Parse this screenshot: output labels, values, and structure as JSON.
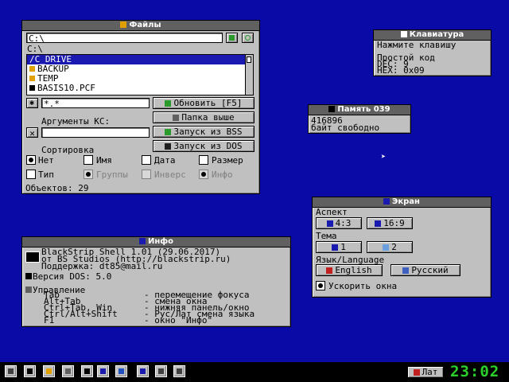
{
  "files_window": {
    "title": "Файлы",
    "path_value": "C:\\",
    "current_dir": "C:\\",
    "items": [
      {
        "label": "/C_DRIVE",
        "selected": true
      },
      {
        "label": "BACKUP",
        "selected": false
      },
      {
        "label": "TEMP",
        "selected": false
      },
      {
        "label": "BASIS10.PCF",
        "selected": false
      }
    ],
    "mask_value": "*.*",
    "refresh_label": "Обновить [F5]",
    "up_label": "Папка выше",
    "args_label": "Аргументы КС:",
    "run_bss_label": "Запуск из BSS",
    "run_dos_label": "Запуск из DOS",
    "sort_label": "Сортировка",
    "sort_none": "Нет",
    "sort_name": "Имя",
    "sort_date": "Дата",
    "sort_size": "Размер",
    "sort_type": "Тип",
    "sort_groups": "Группы",
    "sort_invert": "Инверс",
    "sort_info": "Инфо",
    "object_count": "Объектов: 29"
  },
  "keyboard_window": {
    "title": "Клавиатура",
    "prompt": "Нажмите клавишу",
    "simple_code_label": "Простой код",
    "dec_line": "DEC: 9",
    "hex_line": "HEX: 0x09"
  },
  "memory_window": {
    "title": "Память 039",
    "bytes": "416896",
    "free_label": "байт свободно"
  },
  "screen_window": {
    "title": "Экран",
    "aspect_label": "Аспект",
    "aspect_43": "4:3",
    "aspect_169": "16:9",
    "theme_label": "Тема",
    "theme_1": "1",
    "theme_2": "2",
    "lang_label": "Язык/Language",
    "lang_en": "English",
    "lang_ru": "Русский",
    "speed_label": "Ускорить окна"
  },
  "info_window": {
    "title": "Инфо",
    "line1": "BlackStrip Shell 1.01 (29.06.2017)",
    "line2": "от BS Studios (http://blackstrip.ru)",
    "line3": "Поддержка: dt85@mail.ru",
    "dos_version": "Версия DOS: 5.0",
    "controls_label": "Управление",
    "controls": [
      {
        "key": "Tab",
        "desc": "- перемещение фокуса"
      },
      {
        "key": "Alt+Tab",
        "desc": "- смена окна"
      },
      {
        "key": "Ctrl+Tab, Win",
        "desc": "- нижняя панель/окно"
      },
      {
        "key": "Ctrl/Alt+Shift",
        "desc": "- Рус/Лат смена языка"
      },
      {
        "key": "F1",
        "desc": "- окно \"Инфо\""
      }
    ]
  },
  "taskbar": {
    "lang_button": "Лат",
    "clock": "23:02"
  },
  "colors": {
    "desktop": "#0a0aa6",
    "window": "#c0c0c0",
    "title": "#606060",
    "selection": "#1a1ab0",
    "clock": "#2bd12b"
  }
}
